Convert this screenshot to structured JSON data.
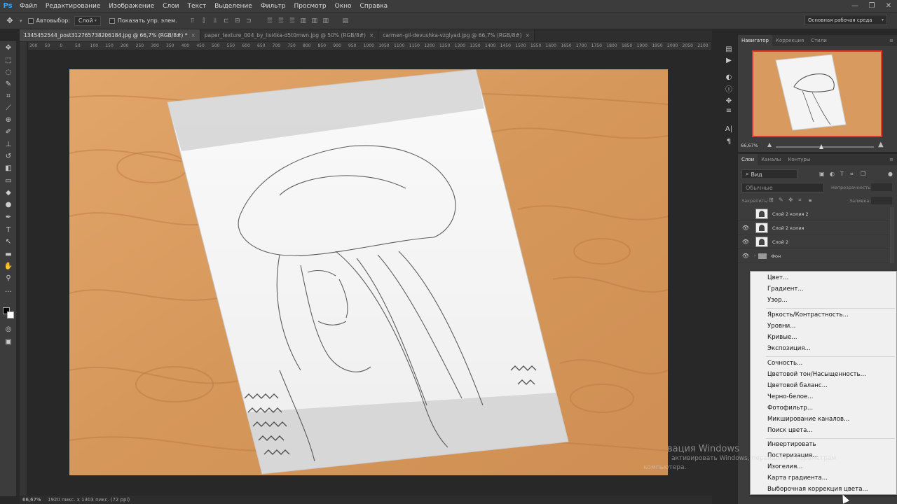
{
  "app": {
    "logo": "Ps"
  },
  "menubar": {
    "items": [
      "Файл",
      "Редактирование",
      "Изображение",
      "Слои",
      "Текст",
      "Выделение",
      "Фильтр",
      "Просмотр",
      "Окно",
      "Справка"
    ],
    "window_controls": [
      "—",
      "❐",
      "✕"
    ]
  },
  "options": {
    "auto_select_label": "Автовыбор:",
    "auto_select_value": "Слой",
    "show_controls_label": "Показать упр. элем.",
    "workspace": "Основная рабочая среда"
  },
  "tabs": [
    {
      "label": "1345452544_post312765738206184.jpg @ 66,7% (RGB/8#) *",
      "active": true,
      "close": "×"
    },
    {
      "label": "paper_texture_004_by_lisi4ka-d5t0mwn.jpg @ 50% (RGB/8#)",
      "active": false,
      "close": "×"
    },
    {
      "label": "carmen-gil-devushka-vzglyad.jpg @ 66,7% (RGB/8#)",
      "active": false,
      "close": "×"
    }
  ],
  "ruler": {
    "labels": [
      "300",
      "50",
      "0",
      "50",
      "100",
      "150",
      "200",
      "250",
      "300",
      "350",
      "400",
      "450",
      "500",
      "550",
      "600",
      "650",
      "700",
      "750",
      "800",
      "850",
      "900",
      "950",
      "1000",
      "1050",
      "1100",
      "1150",
      "1200",
      "1250",
      "1300",
      "1350",
      "1400",
      "1450",
      "1500",
      "1550",
      "1600",
      "1650",
      "1700",
      "1750",
      "1800",
      "1850",
      "1900",
      "1950",
      "2000",
      "2050",
      "2100"
    ]
  },
  "status": {
    "zoom": "66,67%",
    "doc_info": "1920 пикс. x 1303 пикс. (72 ppi)"
  },
  "navigator": {
    "tabs": [
      "Навигатор",
      "Коррекция",
      "Стили"
    ],
    "zoom": "66,67%"
  },
  "layers": {
    "tabs": [
      "Слои",
      "Каналы",
      "Контуры"
    ],
    "filter": "Вид",
    "blend_mode": "Обычные",
    "opacity_label": "Непрозрачность:",
    "lock_label": "Закрепить:",
    "fill_label": "Заливка:",
    "rows": [
      {
        "name": "Слой 2 копия 2",
        "visible": false
      },
      {
        "name": "Слой 2 копия",
        "visible": true
      },
      {
        "name": "Слой 2",
        "visible": true
      },
      {
        "name": "Фон",
        "visible": true,
        "group": true
      }
    ]
  },
  "context_menu": {
    "group1": [
      "Цвет...",
      "Градиент...",
      "Узор..."
    ],
    "group2": [
      "Яркость/Контрастность...",
      "Уровни...",
      "Кривые...",
      "Экспозиция..."
    ],
    "group3": [
      "Сочность...",
      "Цветовой тон/Насыщенность...",
      "Цветовой баланс...",
      "Черно-белое...",
      "Фотофильтр...",
      "Микширование каналов...",
      "Поиск цвета..."
    ],
    "group4": [
      "Инвертировать",
      "Постеризация...",
      "Изогелия...",
      "Карта градиента...",
      "Выборочная коррекция цвета..."
    ]
  },
  "watermark": {
    "line1": "вация Windows",
    "line2": "активировать Windows, перейдите к параметрам",
    "line3": "компьютера."
  },
  "colors": {
    "accent": "#31a8ff",
    "nav_frame": "#e0362b",
    "wood": "#d89a5e",
    "panel": "#3c3c3c"
  }
}
